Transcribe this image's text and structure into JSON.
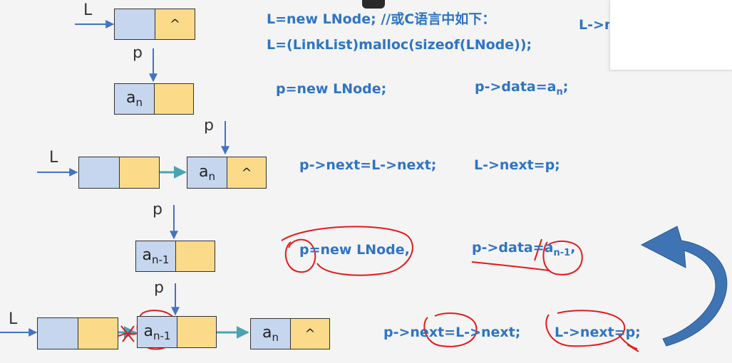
{
  "labels": {
    "L": "L",
    "p": "p",
    "null": "^"
  },
  "cells": {
    "an": {
      "base": "a",
      "sub": "n"
    },
    "an1": {
      "base": "a",
      "sub": "n-1"
    }
  },
  "code": {
    "step1_line1": "L=new LNode; //或C语言中如下：",
    "step1_line2": "L=(LinkList)malloc(sizeof(LNode));",
    "step1_right": "L->n",
    "step2_new": "p=new LNode;",
    "step2_data_prefix": "p->data=a",
    "step2_data_sub": "n",
    "step2_data_suffix": ";",
    "step3_link": "p->next=L->next;",
    "step3_head": "L->next=p;",
    "step4_new": "p=new LNode,",
    "step4_data_prefix": "p->data=a",
    "step4_data_sub": "n-1",
    "step4_data_suffix": ",",
    "step5_link": "p->next=L->next;",
    "step5_head": "L->next=p;"
  },
  "colors": {
    "code_blue": "#2e74c4",
    "data_field": "#c5d6ee",
    "next_field": "#fbdb8a",
    "pointer_arrow": "#4472c4",
    "link_arrow": "#4aa3b5",
    "annotation_red": "#e31a1a",
    "curved_arrow": "#3f74b4"
  }
}
